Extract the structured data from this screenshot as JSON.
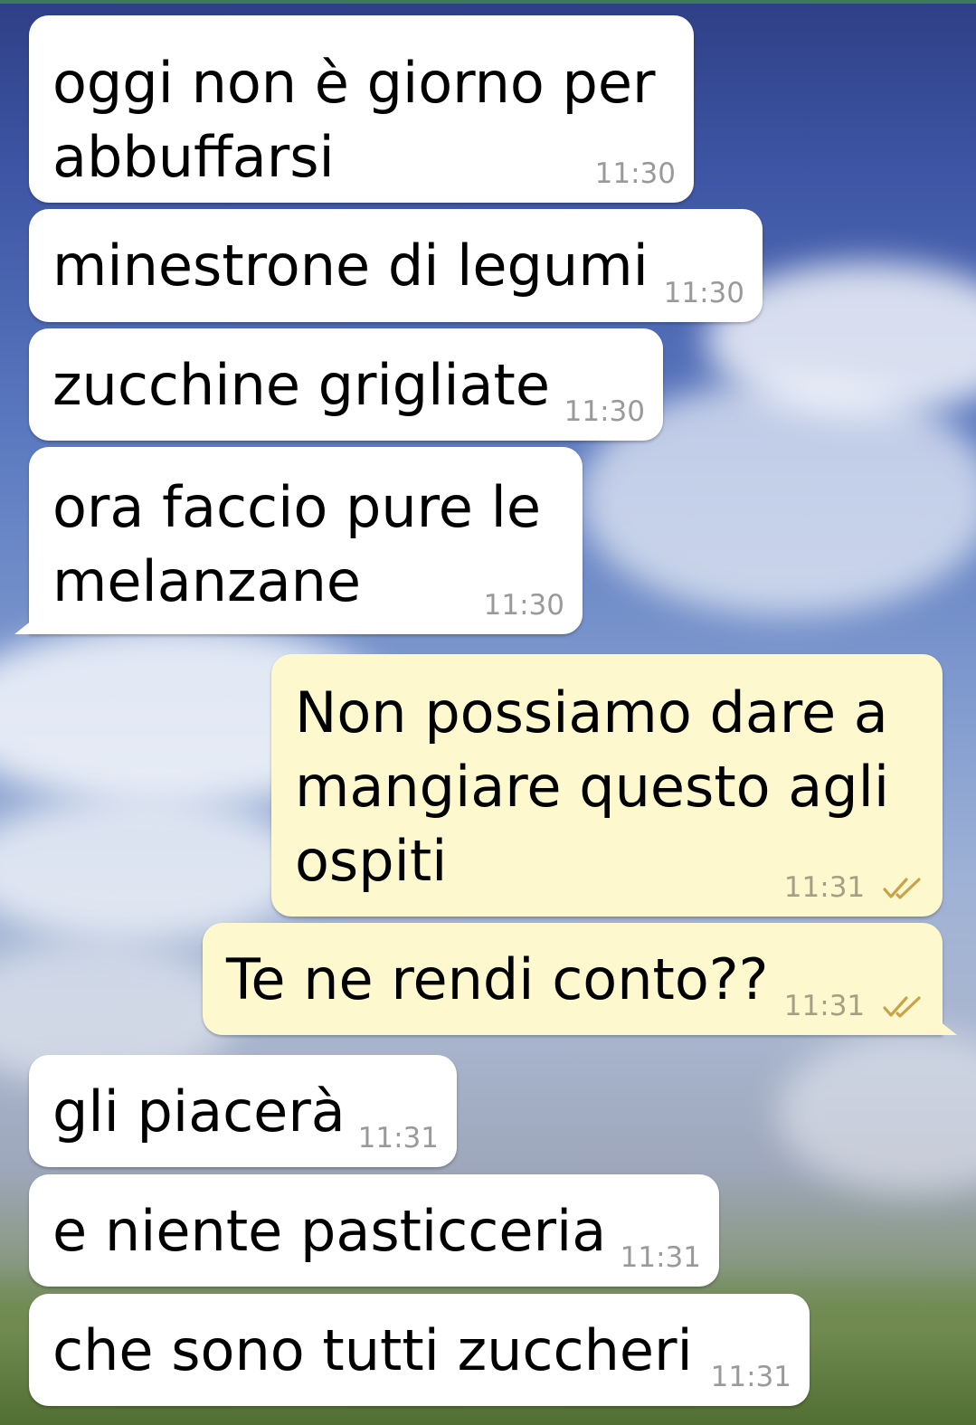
{
  "chat": {
    "messages": [
      {
        "direction": "in",
        "text": "oggi non è giorno per\nabbuffarsi",
        "time": "11:30"
      },
      {
        "direction": "in",
        "text": "minestrone di legumi",
        "time": "11:30"
      },
      {
        "direction": "in",
        "text": "zucchine grigliate",
        "time": "11:30"
      },
      {
        "direction": "in",
        "text": "ora faccio pure le\nmelanzane",
        "time": "11:30"
      },
      {
        "direction": "out",
        "text": "Non possiamo dare a\nmangiare questo agli\nospiti",
        "time": "11:31",
        "status": "read"
      },
      {
        "direction": "out",
        "text": "Te ne rendi conto??",
        "time": "11:31",
        "status": "read"
      },
      {
        "direction": "in",
        "text": "gli piacerà",
        "time": "11:31"
      },
      {
        "direction": "in",
        "text": "e niente pasticceria",
        "time": "11:31"
      },
      {
        "direction": "in",
        "text": "che sono tutti zuccheri",
        "time": "11:31"
      }
    ]
  },
  "colors": {
    "incoming_bubble": "#ffffff",
    "outgoing_bubble": "#fdf8ce",
    "read_check": "#c9a24a",
    "timestamp": "#9a9a9a"
  },
  "icons": {
    "read_receipt": "double-check-icon"
  }
}
